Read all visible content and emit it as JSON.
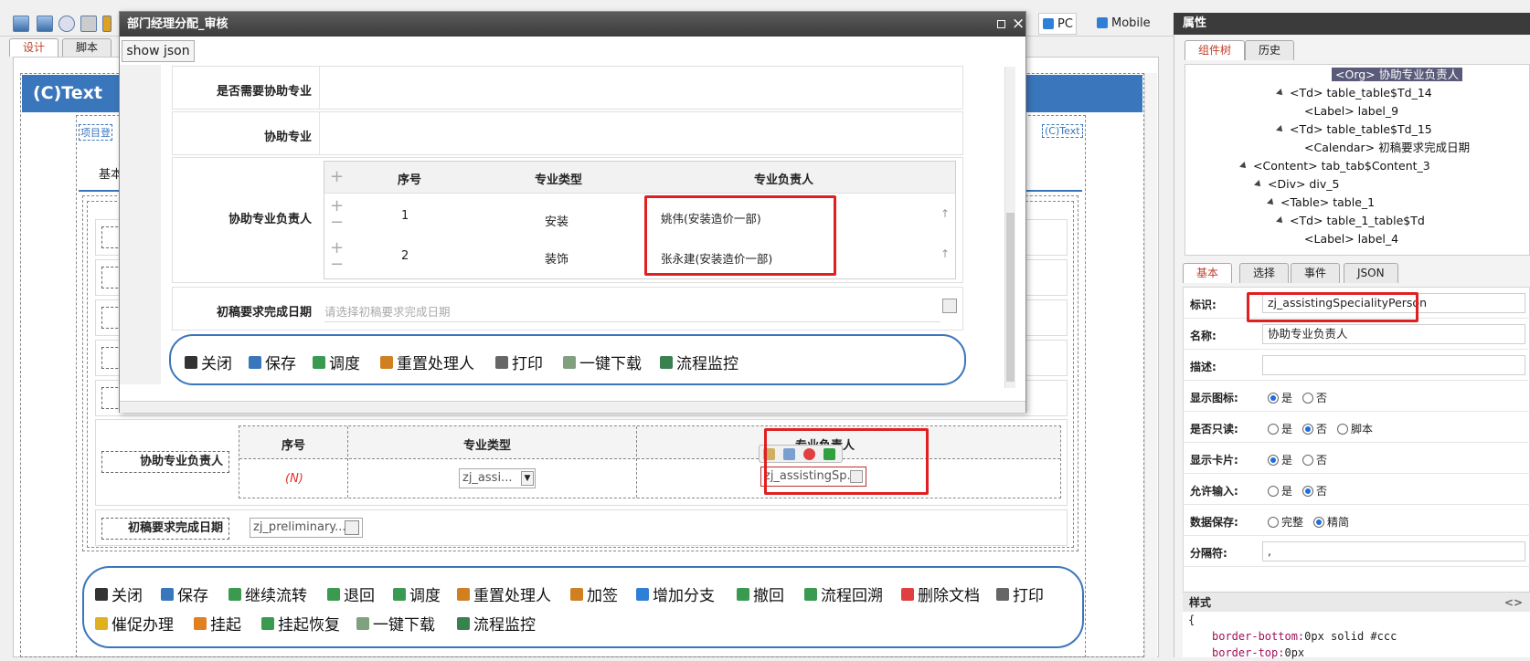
{
  "view_tabs": {
    "pc": "PC",
    "mobile": "Mobile"
  },
  "design_tabs": [
    "设计",
    "脚本"
  ],
  "canvas": {
    "header_title": "(C)Text",
    "left_link_partial": "项目登",
    "right_link_partial": "(C)Text",
    "tab_partial": "基本",
    "rows": {
      "assist_person_label": "协助专业负责人",
      "date_label": "初稿要求完成日期",
      "date_field": "zj_preliminary...",
      "grid_headers": [
        "序号",
        "专业类型",
        "专业负责人"
      ],
      "grid_row_n": "(N)",
      "grid_type_field": "zj_assi...",
      "grid_person_field": "zj_assistingSp..."
    },
    "buttons_row1": [
      "关闭",
      "保存",
      "继续流转",
      "退回",
      "调度",
      "重置处理人",
      "加签",
      "增加分支",
      "撤回",
      "流程回溯",
      "删除文档",
      "打印"
    ],
    "buttons_row2": [
      "催促办理",
      "挂起",
      "挂起恢复",
      "一键下载",
      "流程监控"
    ]
  },
  "dialog": {
    "title": "部门经理分配_审核",
    "show_json": "show json",
    "labels": {
      "need_assist": "是否需要协助专业",
      "assist_spec": "协助专业",
      "assist_person": "协助专业负责人",
      "date": "初稿要求完成日期"
    },
    "sub_headers": [
      "序号",
      "专业类型",
      "专业负责人"
    ],
    "sub_rows": [
      {
        "no": "1",
        "type": "安装",
        "person": "姚伟(安装造价一部)"
      },
      {
        "no": "2",
        "type": "装饰",
        "person": "张永建(安装造价一部)"
      }
    ],
    "date_placeholder": "请选择初稿要求完成日期",
    "buttons": [
      "关闭",
      "保存",
      "调度",
      "重置处理人",
      "打印",
      "一键下载",
      "流程监控"
    ]
  },
  "right_panel": {
    "title": "属性",
    "top_tabs": [
      "组件树",
      "历史"
    ],
    "tree": [
      {
        "text": "<Org> 协助专业负责人",
        "selected": true
      },
      {
        "text": "<Td> table_table$Td_14",
        "expander": true
      },
      {
        "text": "<Label> label_9"
      },
      {
        "text": "<Td> table_table$Td_15",
        "expander": true
      },
      {
        "text": "<Calendar> 初稿要求完成日期"
      },
      {
        "text": "<Content> tab_tab$Content_3",
        "expander": true
      },
      {
        "text": "<Div> div_5",
        "expander": true
      },
      {
        "text": "<Table> table_1",
        "expander": true
      },
      {
        "text": "<Td> table_1_table$Td",
        "expander": true
      },
      {
        "text": "<Label> label_4"
      }
    ],
    "prop_tabs": [
      "基本",
      "选择",
      "事件",
      "JSON"
    ],
    "props": {
      "id_label": "标识:",
      "id_value": "zj_assistingSpecialityPerson",
      "name_label": "名称:",
      "name_value": "协助专业负责人",
      "desc_label": "描述:",
      "desc_value": "",
      "show_icon_label": "显示图标:",
      "readonly_label": "是否只读:",
      "show_card_label": "显示卡片:",
      "allow_input_label": "允许输入:",
      "save_label": "数据保存:",
      "sep_label": "分隔符:",
      "sep_value": ",",
      "yes": "是",
      "no": "否",
      "script": "脚本",
      "full": "完整",
      "simple": "精简"
    },
    "style_title": "样式",
    "style_lines": [
      "{",
      "border-bottom:",
      "0px solid #ccc",
      "border-top:",
      "0px"
    ]
  },
  "colors": {
    "accent": "#3a76bb",
    "highlight": "#e02020",
    "tree_selected": "#5a5a7a"
  }
}
